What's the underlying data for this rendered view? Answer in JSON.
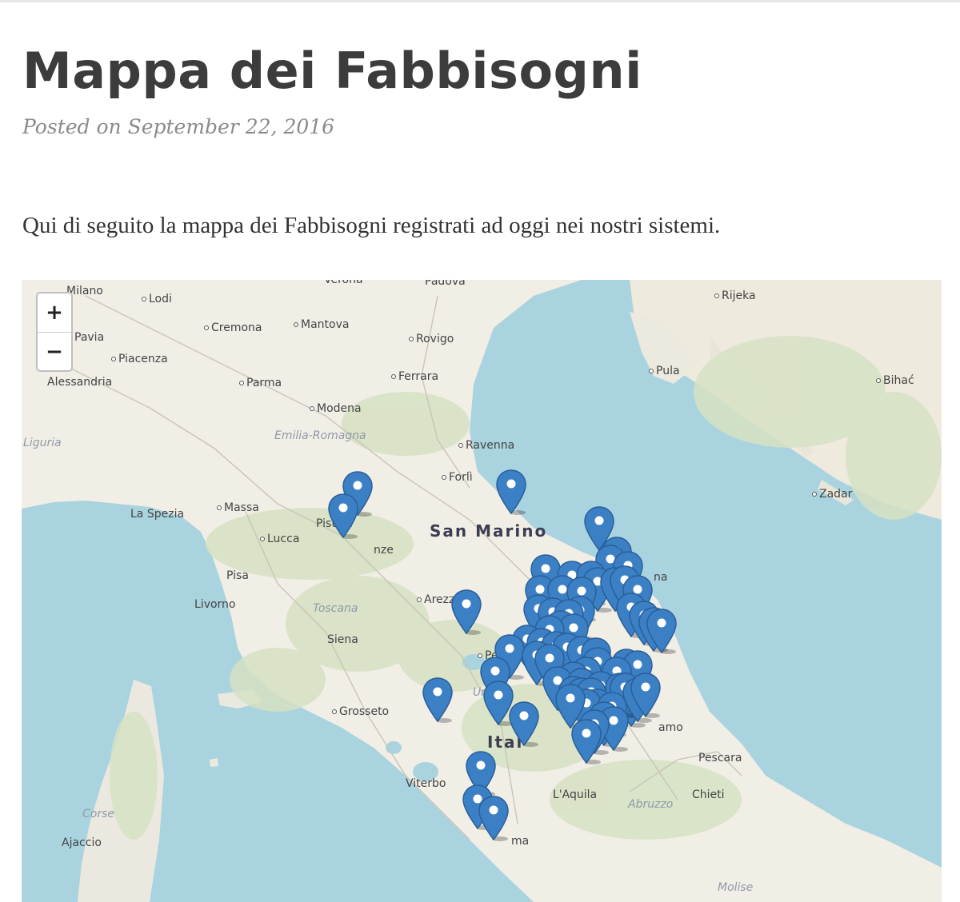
{
  "article": {
    "title": "Mappa dei Fabbisogni",
    "posted": "Posted on September 22, 2016",
    "intro": "Qui di seguito la mappa dei Fabbisogni registrati ad oggi nei nostri sistemi."
  },
  "map": {
    "zoom_in_label": "+",
    "zoom_out_label": "−",
    "marker_icon": "map-marker-icon",
    "marker_color": "#3b7fc4",
    "sea_color": "#a9d3df",
    "land_color": "#f1eee6",
    "places": [
      "Milano",
      "Lodi",
      "Pavia",
      "Cremona",
      "Mantova",
      "Rovigo",
      "Padova",
      "Verona",
      "Piacenza",
      "Alessandria",
      "Parma",
      "Ferrara",
      "Modena",
      "Ravenna",
      "Forlì",
      "La Spezia",
      "Massa",
      "Pistoia",
      "Lucca",
      "Pisa",
      "Livorno",
      "Arezzo",
      "Siena",
      "Perugia",
      "Grosseto",
      "Viterbo",
      "Ajaccio",
      "L'Aquila",
      "Pescara",
      "Chieti",
      "Rijeka",
      "Pula",
      "Bihać",
      "Zadar"
    ],
    "place_fragments": [
      "nze",
      "ma",
      "amo",
      "na"
    ],
    "regions": [
      "Liguria",
      "Emilia-Romagna",
      "Toscana",
      "Umbria",
      "Corse",
      "Abruzzo",
      "Molise"
    ],
    "countries": [
      "San Marino",
      "Ital"
    ]
  }
}
